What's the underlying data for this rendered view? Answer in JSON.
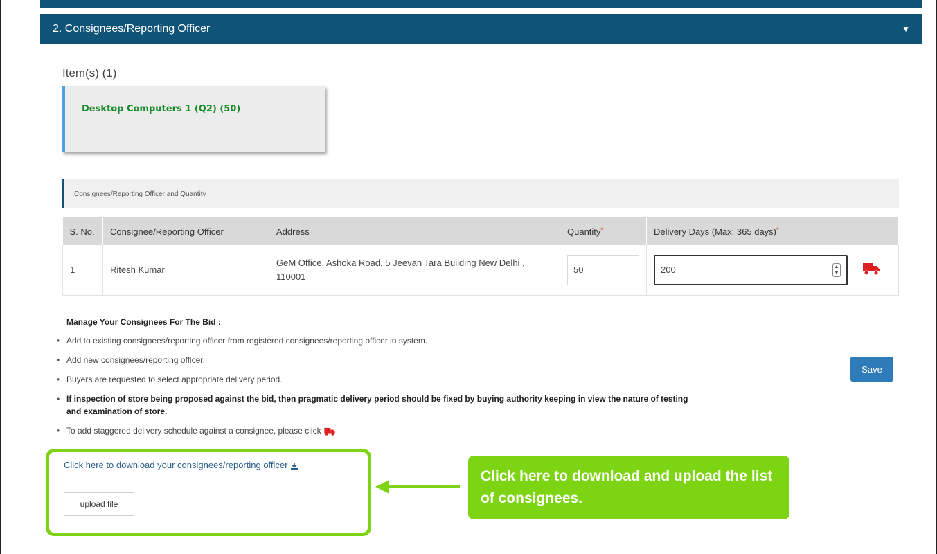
{
  "section": {
    "title": "2. Consignees/Reporting Officer"
  },
  "items": {
    "heading": "Item(s) (1)",
    "card": {
      "name": "Desktop Computers 1  (Q2)  (50)"
    }
  },
  "sub_header": "Consignees/Reporting Officer and Quantity",
  "table": {
    "headers": {
      "sno": "S. No.",
      "consignee": "Consignee/Reporting Officer",
      "address": "Address",
      "quantity": "Quantity",
      "delivery": "Delivery Days (Max: 365 days)"
    },
    "required_mark": "*",
    "rows": [
      {
        "sno": "1",
        "consignee": "Ritesh Kumar",
        "address": "GeM Office, Ashoka Road, 5 Jeevan Tara Building New Delhi , 110001",
        "quantity": "50",
        "delivery_days": "200"
      }
    ]
  },
  "manage": {
    "title": "Manage Your Consignees For The Bid :",
    "notes": [
      "Add to existing consignees/reporting officer from registered consignees/reporting officer in system.",
      "Add new consignees/reporting officer.",
      "Buyers are requested to select appropriate delivery period.",
      "If inspection of store being proposed against the bid, then pragmatic delivery period should be fixed by buying authority keeping in view the nature of testing and examination of store.",
      "To add staggered delivery schedule against a consignee, please click"
    ]
  },
  "buttons": {
    "save": "Save",
    "upload": "upload file"
  },
  "download_link": "Click here to download your consignees/reporting officer",
  "callout": "Click here to download and upload the list of consignees.",
  "colors": {
    "header": "#0f5478",
    "accent_green": "#7dd412",
    "save": "#2d7bb8",
    "truck": "#e02020"
  },
  "icons": {
    "caret": "caret-down-icon",
    "truck": "truck-icon",
    "download": "download-icon"
  }
}
